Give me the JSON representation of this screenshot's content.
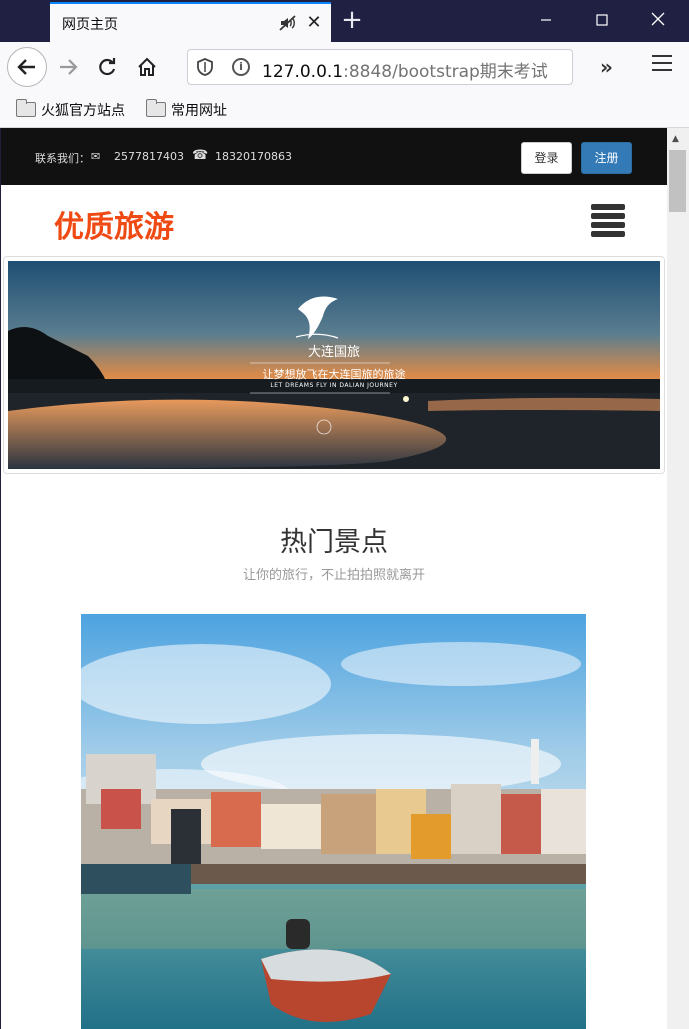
{
  "browser": {
    "tab_title": "网页主页",
    "url_host": "127.0.0.1",
    "url_rest": ":8848/bootstrap期末考试",
    "bookmarks": [
      "火狐官方站点",
      "常用网址"
    ]
  },
  "topbar": {
    "contact_label": "联系我们：",
    "phone1": "2577817403",
    "phone2": "18320170863",
    "login": "登录",
    "register": "注册"
  },
  "brand": {
    "title": "优质旅游",
    "color": "#f04a14"
  },
  "banner": {
    "title": "大连国旅",
    "subtitle": "让梦想放飞在大连国旅的旅途",
    "subtitle_en": "LET DREAMS FLY IN DALIAN JOURNEY"
  },
  "section": {
    "title": "热门景点",
    "subtitle": "让你的旅行，不止拍拍照就离开"
  },
  "icons": [
    "mute-icon",
    "close-icon",
    "plus-icon",
    "back-icon",
    "forward-icon",
    "reload-icon",
    "home-icon",
    "shield-icon",
    "info-icon",
    "overflow-icon",
    "menu-icon",
    "folder-icon",
    "mail-icon",
    "phone-icon",
    "hamburger-icon"
  ]
}
